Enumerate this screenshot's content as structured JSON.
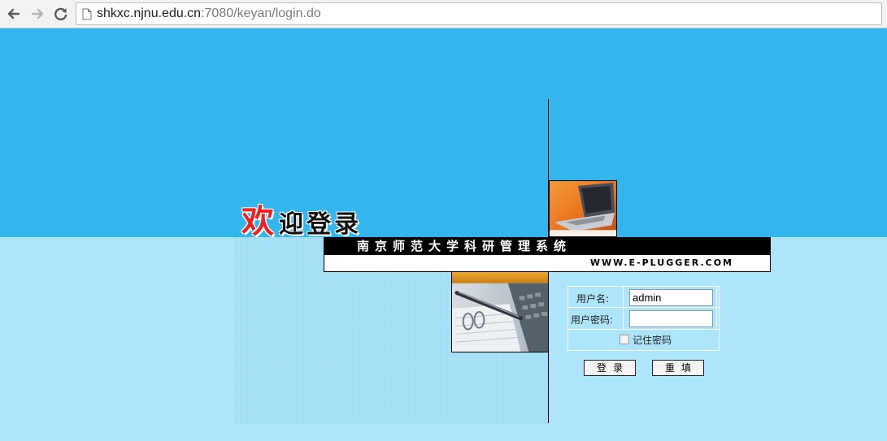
{
  "browser": {
    "url_host": "shkxc.njnu.edu.cn",
    "url_path": ":7080/keyan/login.do",
    "icons": [
      "back-arrow-icon",
      "forward-arrow-icon",
      "reload-icon",
      "page-icon"
    ]
  },
  "page": {
    "welcome_first": "欢",
    "welcome_rest": "迎登录",
    "system_name": "南京师范大学科研管理系统",
    "website": "WWW.E-PLUGGER.COM",
    "colors": {
      "top_band": "#33b6ee",
      "bottom_band": "#ade6fb",
      "welcome_accent": "#ee2020"
    }
  },
  "login": {
    "username_label": "用户名:",
    "username_value": "admin",
    "password_label": "用户密码:",
    "password_value": "",
    "remember_label": "记住密码",
    "login_button": "登录",
    "reset_button": "重填"
  }
}
